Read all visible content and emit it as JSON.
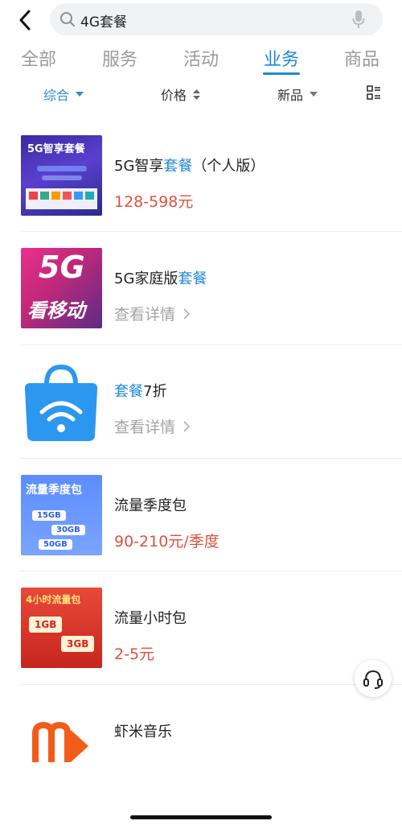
{
  "search": {
    "query": "4G套餐"
  },
  "tabs": [
    {
      "label": "全部"
    },
    {
      "label": "服务"
    },
    {
      "label": "活动"
    },
    {
      "label": "业务"
    },
    {
      "label": "商品"
    }
  ],
  "filters": {
    "sort": "综合",
    "price": "价格",
    "new": "新品"
  },
  "items": [
    {
      "title_plain": "5G智享",
      "title_hl": "套餐",
      "title_rest": "（个人版）",
      "sub": "128-598元",
      "thumb_text": "5G智享套餐"
    },
    {
      "title_plain": "5G家庭版",
      "title_hl": "套餐",
      "title_rest": "",
      "sub": "查看详情",
      "thumb_text_top": "5G",
      "thumb_text_bottom": "看移动"
    },
    {
      "title_plain": "",
      "title_hl": "套餐",
      "title_rest": "7折",
      "sub": "查看详情"
    },
    {
      "title_plain": "流量季度包",
      "title_hl": "",
      "title_rest": "",
      "sub": "90-210元/季度",
      "thumb_text": "流量季度包",
      "thumb_rows": [
        "15GB",
        "30GB",
        "50GB"
      ]
    },
    {
      "title_plain": "流量小时包",
      "title_hl": "",
      "title_rest": "",
      "sub": "2-5元",
      "thumb_text": "4小时流量包",
      "thumb_rows": [
        "1GB",
        "3GB"
      ]
    },
    {
      "title_plain": "虾米音乐",
      "title_hl": "",
      "title_rest": "",
      "sub": ""
    }
  ],
  "colors": {
    "accent": "#1f87d6",
    "price": "#d9533f",
    "muted": "#a3a3a3"
  }
}
